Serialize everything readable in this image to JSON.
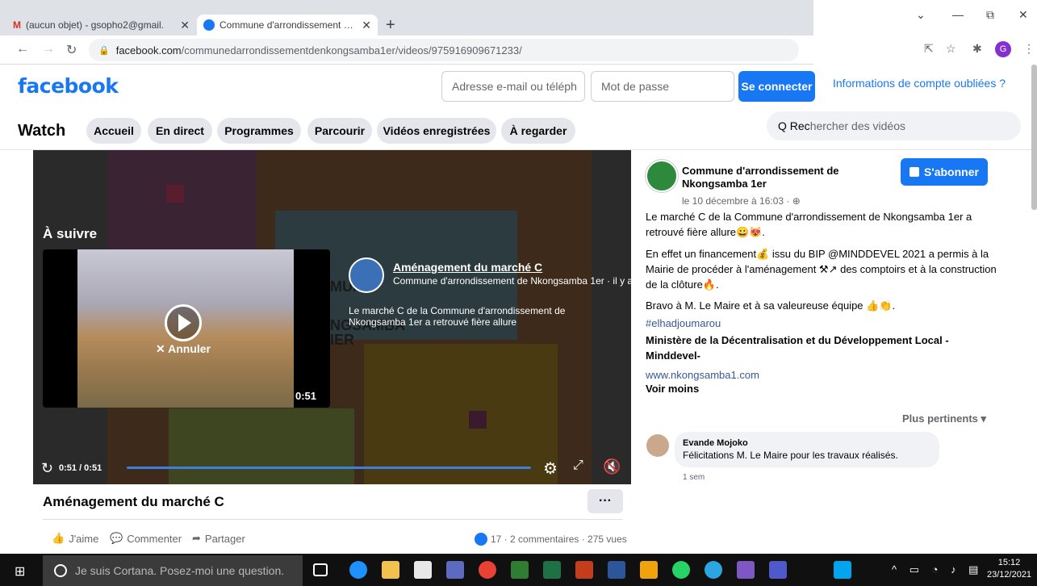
{
  "browser": {
    "tabs": [
      {
        "title": "(aucun objet) - gsopho2@gmail.",
        "icon": "gmail-icon"
      },
      {
        "title": "Commune d'arrondissement de N",
        "icon": "facebook-icon"
      }
    ],
    "url_host": "facebook.com",
    "url_path": "/communedarrondissementdenkongsamba1er/videos/975916909671233/"
  },
  "fb_header": {
    "logo": "facebook",
    "email_placeholder": "Adresse e-mail ou téléph",
    "password_placeholder": "Mot de passe",
    "login_label": "Se connecter",
    "forgot_label": "Informations de compte oubliées ?"
  },
  "watch": {
    "title": "Watch",
    "tabs": [
      "Accueil",
      "En direct",
      "Programmes",
      "Parcourir",
      "Vidéos enregistrées",
      "À regarder"
    ],
    "search_prefix": "Q Rec",
    "search_placeholder": "hercher des vidéos"
  },
  "player": {
    "up_next_label": "À suivre",
    "cancel_label": "✕ Annuler",
    "thumb_duration": "0:51",
    "next_title": "Aménagement du marché C",
    "next_page": "Commune d'arrondissement de Nkongsamba 1er · il y a",
    "next_desc": "Le marché C de la Commune d'arrondissement de Nkongsamba 1er a retrouvé fière allure",
    "time": "0:51 / 0:51",
    "progress_fraction": 1.0,
    "bg_text": [
      "MUNE",
      "NGSAMBA",
      "IER"
    ]
  },
  "video_info": {
    "title": "Aménagement du marché C",
    "more": "···",
    "like": "J'aime",
    "comment": "Commenter",
    "share": "Partager",
    "stats": "17 · 2 commentaires · 275 vues"
  },
  "post": {
    "page_name": "Commune d'arrondissement de Nkongsamba 1er",
    "date": "le 10 décembre à 16:03 · ⊕",
    "subscribe": "S'abonner",
    "para1": "Le marché C de la Commune d'arrondissement de Nkongsamba 1er a retrouvé fière allure😀😻.",
    "para2": "En effet un financement💰 issu du BIP @MINDDEVEL 2021 a permis à la Mairie de procéder à l'aménagement ⚒↗ des comptoirs et à la construction de la clôture🔥.",
    "para3": "Bravo à M. Le Maire et à sa valeureuse équipe 👍👏.",
    "hashtag": "#elhadjoumarou",
    "ministry": "Ministère de la Décentralisation et du Développement Local - Minddevel-",
    "link": "www.nkongsamba1.com",
    "see_less": "Voir moins",
    "sort": "Plus pertinents ▾"
  },
  "comment": {
    "author": "Evande Mojoko",
    "text": "Félicitations M. Le Maire pour les travaux réalisés.",
    "time": "1 sem"
  },
  "taskbar": {
    "search": "Je suis Cortana. Posez-moi une question.",
    "time": "15:12",
    "date": "23/12/2021"
  }
}
